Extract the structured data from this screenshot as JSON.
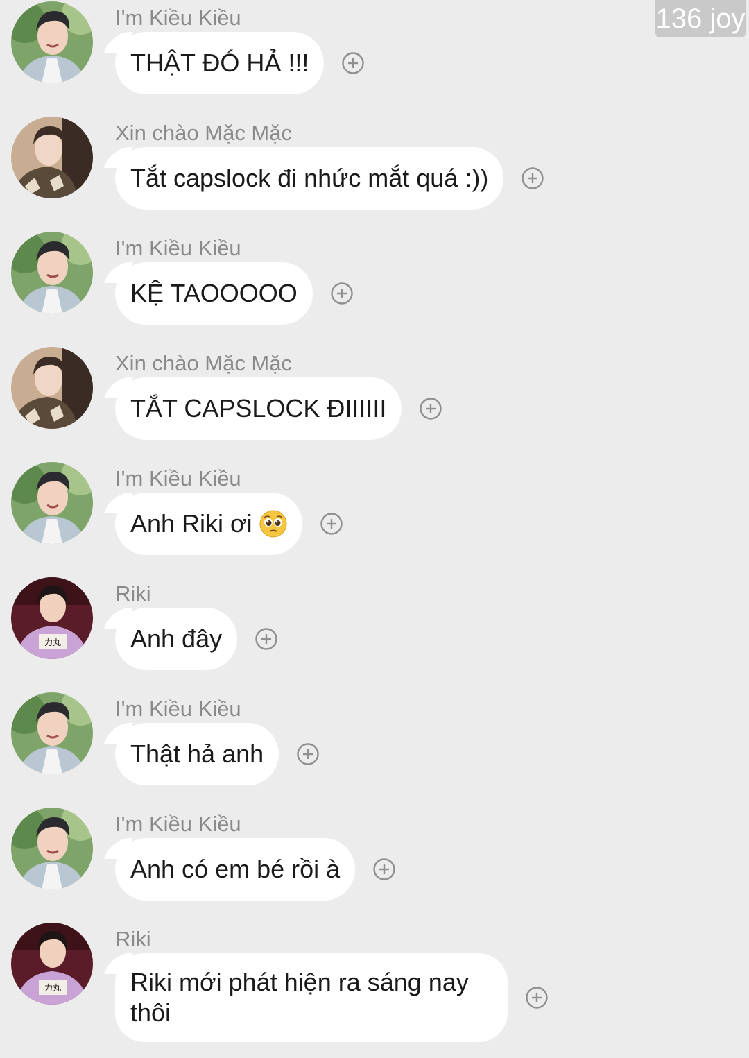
{
  "watermark": "136 joy",
  "colors": {
    "background": "#ececec",
    "bubble": "#ffffff",
    "sender_text": "#8a8a8a",
    "message_text": "#1a1a1a",
    "add_icon": "#8f8f8f",
    "watermark_bg": "#c9c9c9"
  },
  "messages": [
    {
      "sender": "I'm Kiều Kiều",
      "avatar": "kieu-avatar",
      "text": "THẬT ĐÓ HẢ !!!"
    },
    {
      "sender": "Xin chào Mặc Mặc",
      "avatar": "mac-avatar",
      "text": "Tắt capslock đi nhức mắt quá :))"
    },
    {
      "sender": "I'm Kiều Kiều",
      "avatar": "kieu-avatar",
      "text": "KỆ TAOOOOO"
    },
    {
      "sender": "Xin chào Mặc Mặc",
      "avatar": "mac-avatar",
      "text": "TẮT CAPSLOCK ĐIIIIII"
    },
    {
      "sender": "I'm Kiều Kiều",
      "avatar": "kieu-avatar",
      "text": "Anh Riki ơi",
      "emoji": "pleading-face-emoji"
    },
    {
      "sender": "Riki",
      "avatar": "riki-avatar",
      "text": "Anh đây"
    },
    {
      "sender": "I'm Kiều Kiều",
      "avatar": "kieu-avatar",
      "text": "Thật hả anh"
    },
    {
      "sender": "I'm Kiều Kiều",
      "avatar": "kieu-avatar",
      "text": "Anh có em bé rồi à"
    },
    {
      "sender": "Riki",
      "avatar": "riki-avatar",
      "text": "Riki mới phát hiện ra sáng nay thôi"
    }
  ],
  "icons": {
    "add": "plus-circle-icon"
  }
}
